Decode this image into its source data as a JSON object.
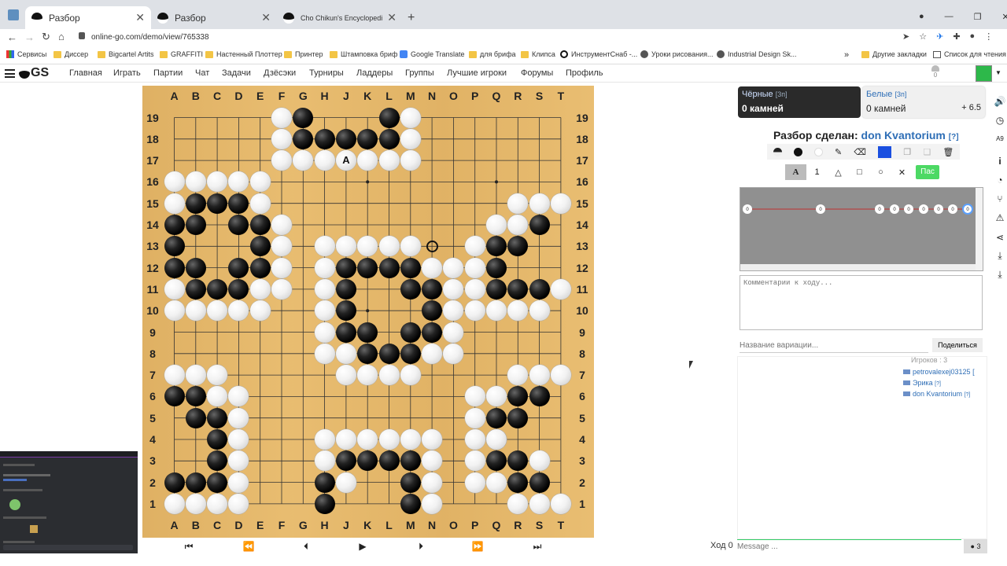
{
  "browser": {
    "tabs": [
      {
        "title": "Разбор",
        "active": true
      },
      {
        "title": "Разбор",
        "active": false
      },
      {
        "title": "Cho Chikun's Encyclopedia of Lif",
        "active": false
      }
    ],
    "url": "online-go.com/demo/view/765338"
  },
  "bookmarks": [
    "Сервисы",
    "Диссер",
    "Bigcartel Artits",
    "GRAFFITI",
    "Настенный Плоттер",
    "Принтер",
    "Штамповка бриф",
    "Google Translate",
    "для брифа",
    "Клипса",
    "ИнструментСнаб -...",
    "Уроки рисования...",
    "Industrial Design Sk..."
  ],
  "bookmarks_right": [
    "Другие закладки",
    "Список для чтения"
  ],
  "site": {
    "logo": "GS",
    "nav": [
      "Главная",
      "Играть",
      "Партии",
      "Чат",
      "Задачи",
      "Дзёсэки",
      "Турниры",
      "Ладдеры",
      "Группы",
      "Лучшие игроки",
      "Форумы",
      "Профиль"
    ],
    "notif_count": "0"
  },
  "board": {
    "columns": [
      "A",
      "B",
      "C",
      "D",
      "E",
      "F",
      "G",
      "H",
      "J",
      "K",
      "L",
      "M",
      "N",
      "O",
      "P",
      "Q",
      "R",
      "S",
      "T"
    ],
    "rows": [
      "19",
      "18",
      "17",
      "16",
      "15",
      "14",
      "13",
      "12",
      "11",
      "10",
      "9",
      "8",
      "7",
      "6",
      "5",
      "4",
      "3",
      "2",
      "1"
    ],
    "black": "1,G19;1,L19;2,G18;2,H18;2,J18;2,K18;2,L18;4,B15;4,C15;4,D15;5,A14;5,B14;5,D14;5,E14;5,R14;5,S14;6,A13;6,E13;6,Q13;6,R13;7,A12;7,B12;7,D12;7,E12;7,J12;7,K12;7,L12;7,M12;7,Q12;8,B11;8,C11;8,D11;8,J11;8,M11;8,N11;8,Q11;8,R11;8,S11;9,J10;9,N10;10,J9;10,K9;10,M9;10,N9;11,K8;11,L8;11,M8;13,A6;13,B6;13,R6;13,S6;14,B5;14,C5;14,Q5;14,R5;15,C4;15,Q4;16,C3;16,J3;16,K3;16,L3;16,M3;16,Q3;16,R3;17,A2;17,B2;17,C2;17,H2;17,M2;17,R2;17,S2;18,H1;18,M1",
    "white": "1,F19;1,M19;2,F18;2,M18;3,F17;3,G17;3,H17;3,J17;3,K17;3,L17;3,M17;4,A16;4,B16;4,C16;4,D16;4,E16;4,A15;4,E15;5,R15;5,S15;5,T15;5,F14;5,Q14;5,R14;5,F13;6,H13;6,J13;6,K13;6,L13;6,M13;6,P13;7,F12;7,H12;7,N12;7,O12;7,P12;8,A11;8,E11;8,F11;8,H11;8,O11;8,P11;8,T11;9,A10;9,B10;9,C10;9,D10;9,E10;9,H10;9,O10;9,P10;9,Q10;9,R10;9,S10;10,H9;10,O9;11,H8;11,J8;11,N8;11,O8;12,A7;12,B7;12,C7;12,J7;12,K7;12,L7;12,M7;12,R7;12,S7;12,T7;13,C6;13,D6;13,P6;13,Q6;14,D5;14,P5;15,D4;15,H4;15,J4;15,K4;15,L4;15,M4;15,N4;15,P4;15,Q4;16,D3;16,H3;16,N3;16,P3;16,S3;17,D2;17,J2;17,N2;17,P2;17,Q2;18,A1;18,B1;18,C1;18,D1;18,N1;18,R1;18,S1;18,T1",
    "label_a": "A",
    "last_move": "N13"
  },
  "controls": {
    "move_label": "Ход 0"
  },
  "players": {
    "black": {
      "name": "Чёрные",
      "rank": "[3п]",
      "stones": "0 камней"
    },
    "white": {
      "name": "Белые",
      "rank": "[3п]",
      "stones": "0 камней",
      "komi": "+ 6.5"
    }
  },
  "review": {
    "label": "Разбор сделан:",
    "user": "don Kvantorium",
    "help": "[?]"
  },
  "tools": {
    "pass_label": "Пас",
    "number_label": "1",
    "letter_label": "A"
  },
  "comment_placeholder": "Комментарии к ходу...",
  "variation_placeholder": "Название вариации...",
  "share_label": "Поделиться",
  "players_list": {
    "header": "Игроков : 3",
    "items": [
      {
        "name": "petrovalexej03125",
        "rank": "["
      },
      {
        "name": "Эрика",
        "rank": "[?]"
      },
      {
        "name": "don Kvantorium",
        "rank": "[?]"
      }
    ]
  },
  "chat": {
    "placeholder": "Message ...",
    "count": "3"
  },
  "colors": {
    "board": "#e6b86a",
    "accent": "#2e6eb6",
    "pass": "#4cd964",
    "blue_swatch": "#1a4fe0"
  }
}
